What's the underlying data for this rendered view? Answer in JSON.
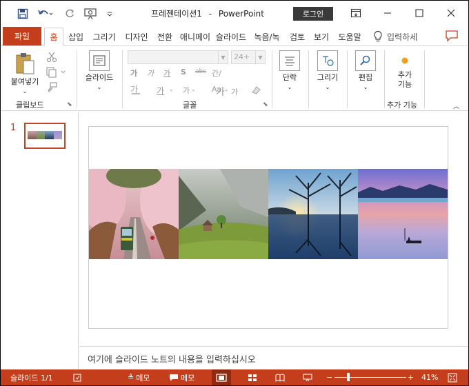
{
  "window": {
    "title": "프레젠테이션1",
    "app_separator": "-",
    "app_name": "PowerPoint",
    "login_label": "로그인"
  },
  "quick_access": [
    "save-icon",
    "undo-icon",
    "redo-icon",
    "slideshow-icon",
    "customize-icon"
  ],
  "tabs": {
    "file": "파일",
    "items": [
      "홈",
      "삽입",
      "그리기",
      "디자인",
      "전환",
      "애니메이",
      "슬라이드",
      "녹음/녹",
      "검토",
      "보기",
      "도움말"
    ],
    "active": "홈",
    "tell_me": "입력하세"
  },
  "ribbon": {
    "clipboard": {
      "paste": "붙여넣기",
      "group": "클립보드"
    },
    "slides": {
      "new_slide": "슬라이드"
    },
    "font": {
      "font_name": "",
      "font_size": "24+",
      "row1": [
        "가",
        "가",
        "가",
        "S",
        "abc",
        "간/"
      ],
      "row2": [
        "가",
        "가",
        "Aa",
        "가",
        "가"
      ],
      "group": "글꼴"
    },
    "paragraph": {
      "label": "단락"
    },
    "drawing": {
      "label": "그리기"
    },
    "editing": {
      "label": "편집"
    },
    "addins": {
      "label_line1": "추가",
      "label_line2": "기능",
      "group": "추가 기능"
    }
  },
  "thumbnails": {
    "slide_number": "1"
  },
  "notes": {
    "placeholder": "여기에 슬라이드 노트의 내용을 입력하십시오"
  },
  "status": {
    "slide_info": "슬라이드 1/1",
    "notes_label": "메모",
    "comments_label": "메모",
    "zoom_minus": "−",
    "zoom_plus": "+",
    "zoom_level": "41%",
    "zoom_fraction": 0.41
  },
  "colors": {
    "accent": "#c43e1c",
    "accent_dark": "#8f2a10"
  }
}
